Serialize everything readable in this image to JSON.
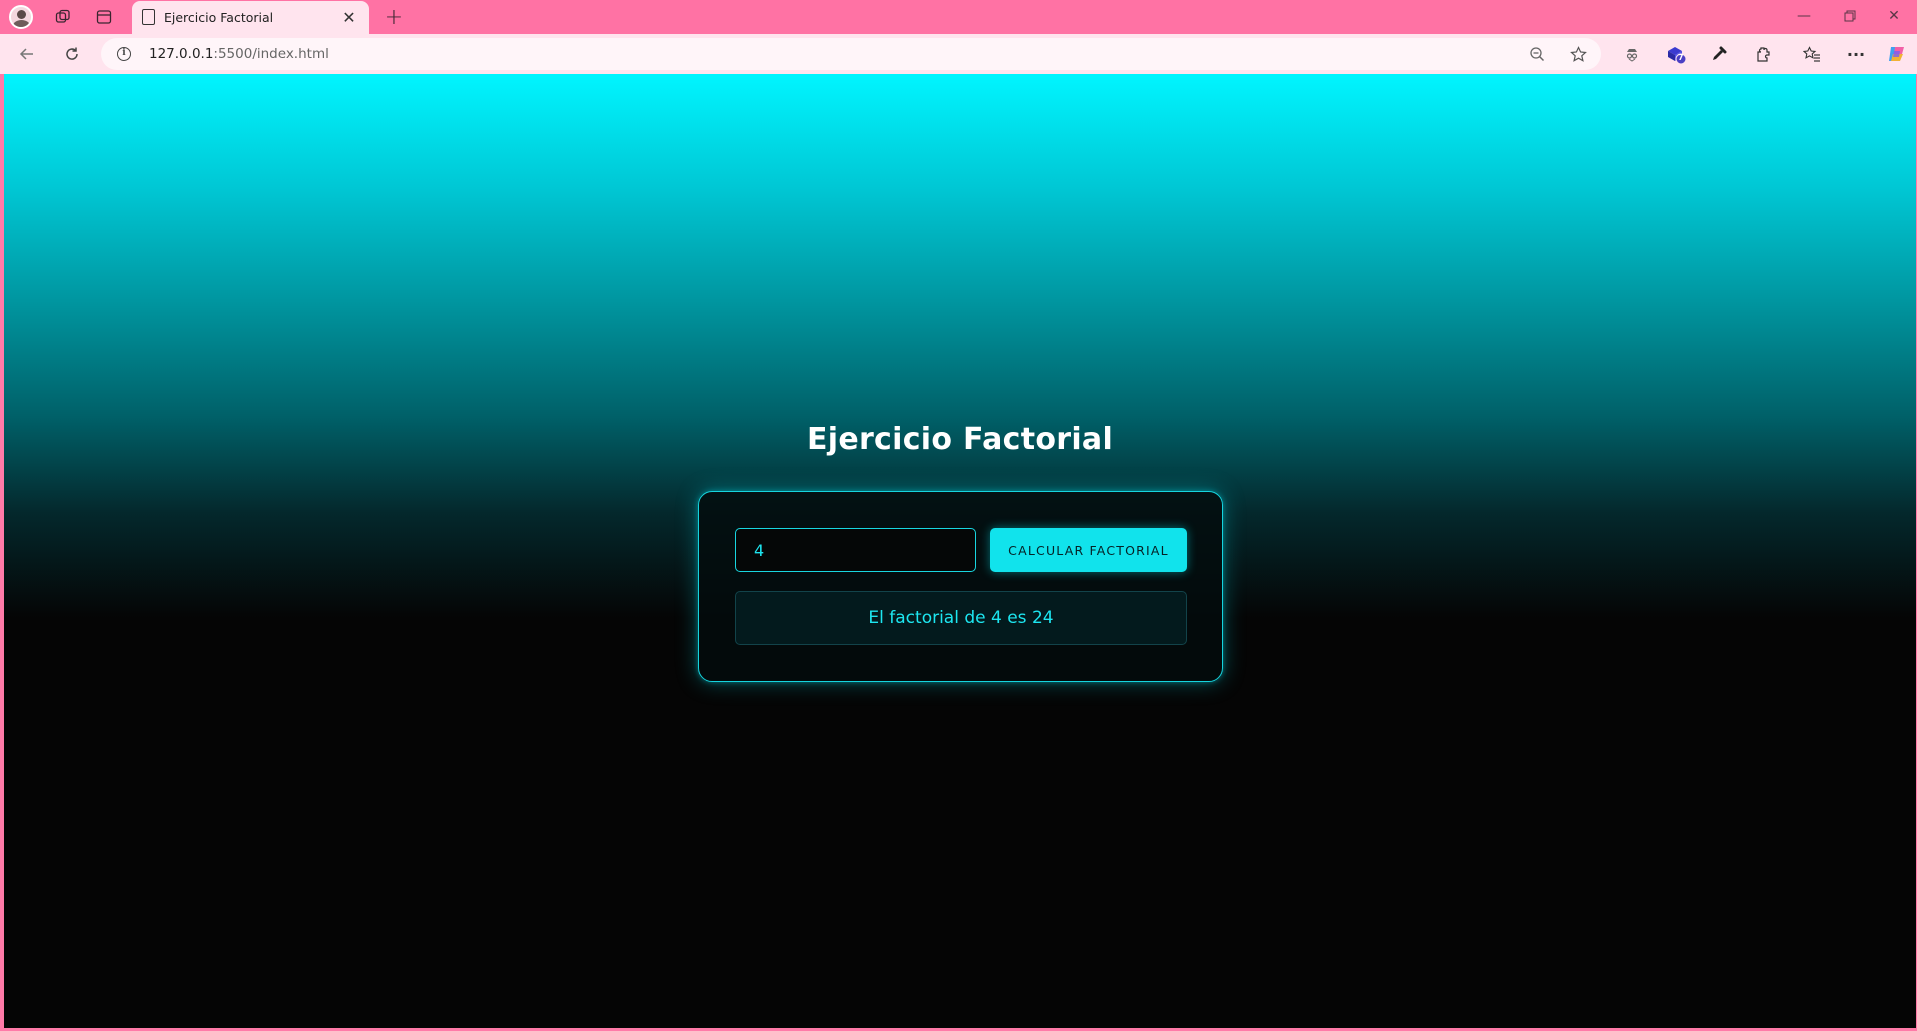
{
  "browser": {
    "tab_title": "Ejercicio Factorial",
    "url_host": "127.0.0.1",
    "url_rest": ":5500/index.html",
    "extension_badge": "7"
  },
  "page": {
    "title": "Ejercicio Factorial",
    "input_value": "4",
    "button_label": "CALCULAR FACTORIAL",
    "result_text": "El factorial de 4 es 24"
  },
  "colors": {
    "accent": "#11e3ec",
    "browser_frame": "#ff72a4",
    "background_dark": "#050505"
  },
  "icons": [
    "profile-avatar",
    "workspaces-icon",
    "tab-actions-icon",
    "page-icon",
    "close-icon",
    "plus-icon",
    "back-icon",
    "reload-icon",
    "info-icon",
    "zoom-out-icon",
    "star-icon",
    "extension-icons",
    "favorites-icon",
    "more-icon",
    "copilot-icon"
  ]
}
